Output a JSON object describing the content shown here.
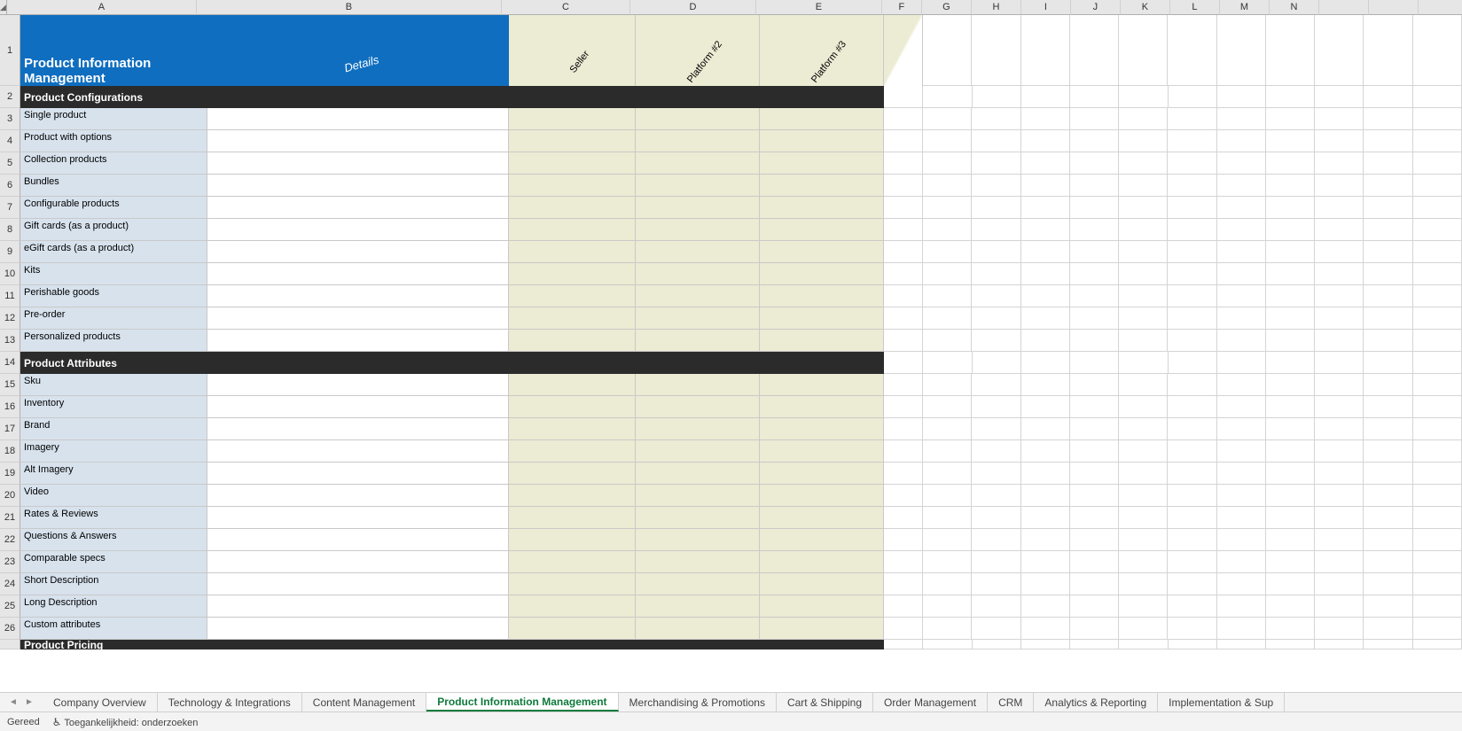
{
  "columns": {
    "letters": [
      "A",
      "B",
      "C",
      "D",
      "E",
      "F",
      "G",
      "H",
      "I",
      "J",
      "K",
      "L",
      "M",
      "N"
    ],
    "widths": [
      214,
      344,
      145,
      142,
      142,
      45,
      56,
      56,
      56,
      56,
      56,
      56,
      56,
      56
    ]
  },
  "rowNumbers": [
    "1",
    "2",
    "3",
    "4",
    "5",
    "6",
    "7",
    "8",
    "9",
    "10",
    "11",
    "12",
    "13",
    "14",
    "15",
    "16",
    "17",
    "18",
    "19",
    "20",
    "21",
    "22",
    "23",
    "24",
    "25",
    "26"
  ],
  "header": {
    "title": "Product Information Management",
    "details": "Details",
    "diagonals": [
      "Seller",
      "Platform #2",
      "Platform #3"
    ]
  },
  "sections": [
    {
      "title": "Product Configurations",
      "rows": [
        "Single product",
        "Product with options",
        "Collection products",
        "Bundles",
        "Configurable products",
        "Gift cards (as a product)",
        "eGift cards (as a product)",
        "Kits",
        "Perishable goods",
        "Pre-order",
        "Personalized products"
      ]
    },
    {
      "title": "Product Attributes",
      "rows": [
        "Sku",
        "Inventory",
        "Brand",
        "Imagery",
        "Alt Imagery",
        "Video",
        "Rates & Reviews",
        "Questions & Answers",
        "Comparable specs",
        "Short Description",
        "Long Description",
        "Custom attributes"
      ]
    },
    {
      "title": "Product Pricing",
      "rows": []
    }
  ],
  "tabs": [
    "Company Overview",
    "Technology & Integrations",
    "Content Management",
    "Product Information Management",
    "Merchandising & Promotions",
    "Cart & Shipping",
    "Order Management",
    "CRM",
    "Analytics & Reporting",
    "Implementation & Sup"
  ],
  "activeTab": "Product Information Management",
  "status": {
    "ready": "Gereed",
    "accessibility": "Toegankelijkheid: onderzoeken"
  }
}
